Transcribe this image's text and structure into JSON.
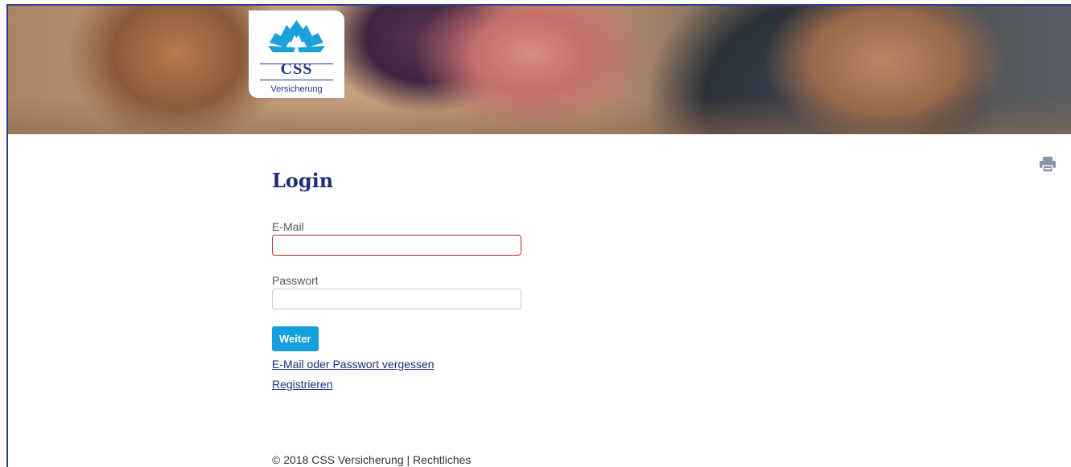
{
  "logo": {
    "name": "CSS",
    "subtitle": "Versicherung"
  },
  "toolbar": {
    "print_icon": "printer-icon"
  },
  "login": {
    "title": "Login",
    "email_label": "E-Mail",
    "email_value": "",
    "password_label": "Passwort",
    "password_value": "",
    "submit_label": "Weiter",
    "forgot_link": "E-Mail oder Passwort vergessen",
    "register_link": "Registrieren"
  },
  "footer": {
    "text": "© 2018 CSS Versicherung | Rechtliches"
  },
  "colors": {
    "brand_blue": "#1f2d78",
    "button_blue": "#14a0dc",
    "error_red": "#b52a2a"
  }
}
